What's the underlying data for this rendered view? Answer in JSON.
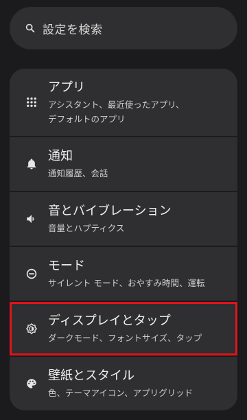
{
  "search": {
    "placeholder": "設定を検索",
    "icon": "search-icon"
  },
  "items": [
    {
      "icon": "apps-grid-icon",
      "title": "アプリ",
      "subtitle_lines": [
        "アシスタント、最近使ったアプリ、",
        "デフォルトのアプリ"
      ]
    },
    {
      "icon": "bell-icon",
      "title": "通知",
      "subtitle_lines": [
        "通知履歴、会話"
      ]
    },
    {
      "icon": "volume-icon",
      "title": "音とバイブレーション",
      "subtitle_lines": [
        "音量とハプティクス"
      ]
    },
    {
      "icon": "do-not-disturb-icon",
      "title": "モード",
      "subtitle_lines": [
        "サイレント モード、おやすみ時間、運転"
      ]
    },
    {
      "icon": "brightness-icon",
      "title": "ディスプレイとタップ",
      "subtitle_lines": [
        "ダークモード、フォントサイズ、タップ"
      ]
    },
    {
      "icon": "palette-icon",
      "title": "壁紙とスタイル",
      "subtitle_lines": [
        "色、テーマアイコン、アプリグリッド"
      ]
    }
  ],
  "highlight_color": "#e0141b"
}
